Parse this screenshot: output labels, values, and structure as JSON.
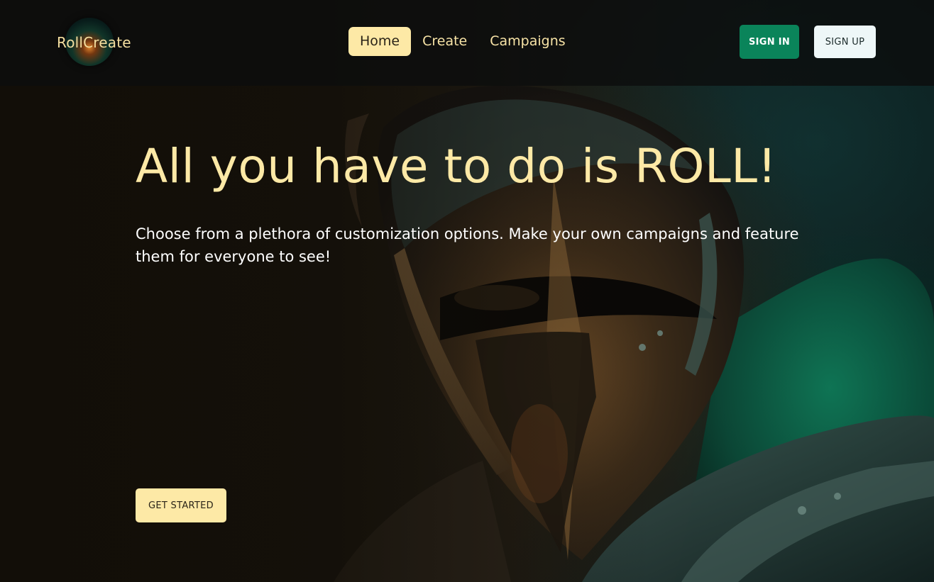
{
  "brand": {
    "name": "RollCreate"
  },
  "nav": {
    "items": [
      {
        "label": "Home",
        "active": true
      },
      {
        "label": "Create",
        "active": false
      },
      {
        "label": "Campaigns",
        "active": false
      }
    ]
  },
  "auth": {
    "sign_in_label": "SIGN IN",
    "sign_up_label": "SIGN UP"
  },
  "hero": {
    "title": "All you have to do is ROLL!",
    "subtitle": "Choose from a plethora of customization options. Make your own campaigns and feature them for everyone to see!",
    "cta_label": "GET STARTED"
  },
  "colors": {
    "accent": "#fde9a6",
    "primary_green": "#0a845a",
    "header_bg": "#0c0e0e",
    "page_bg": "#15120b",
    "signup_bg": "#eef7f8"
  },
  "icons": {
    "logo": "d20-glow-logo",
    "hero_art": "armored-knight-illustration"
  }
}
